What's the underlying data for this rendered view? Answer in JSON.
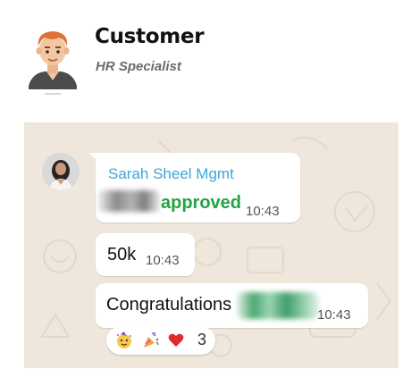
{
  "header": {
    "name": "Customer",
    "role": "HR Specialist",
    "avatar_icon": "cartoon-man-avatar-icon"
  },
  "chat": {
    "wallpaper_color": "#efe6dc",
    "messages": [
      {
        "sender": "Sarah Sheel Mgmt",
        "text": "approved",
        "time": "10:43"
      },
      {
        "text": "50k",
        "time": "10:43"
      },
      {
        "text": "Congratulations",
        "time": "10:43"
      }
    ],
    "reactions": {
      "icons": [
        "party-face-icon",
        "party-popper-icon",
        "red-heart-icon"
      ],
      "count": "3"
    }
  },
  "colors": {
    "sender_name": "#3ea6d7",
    "approved_text": "#25a244"
  }
}
